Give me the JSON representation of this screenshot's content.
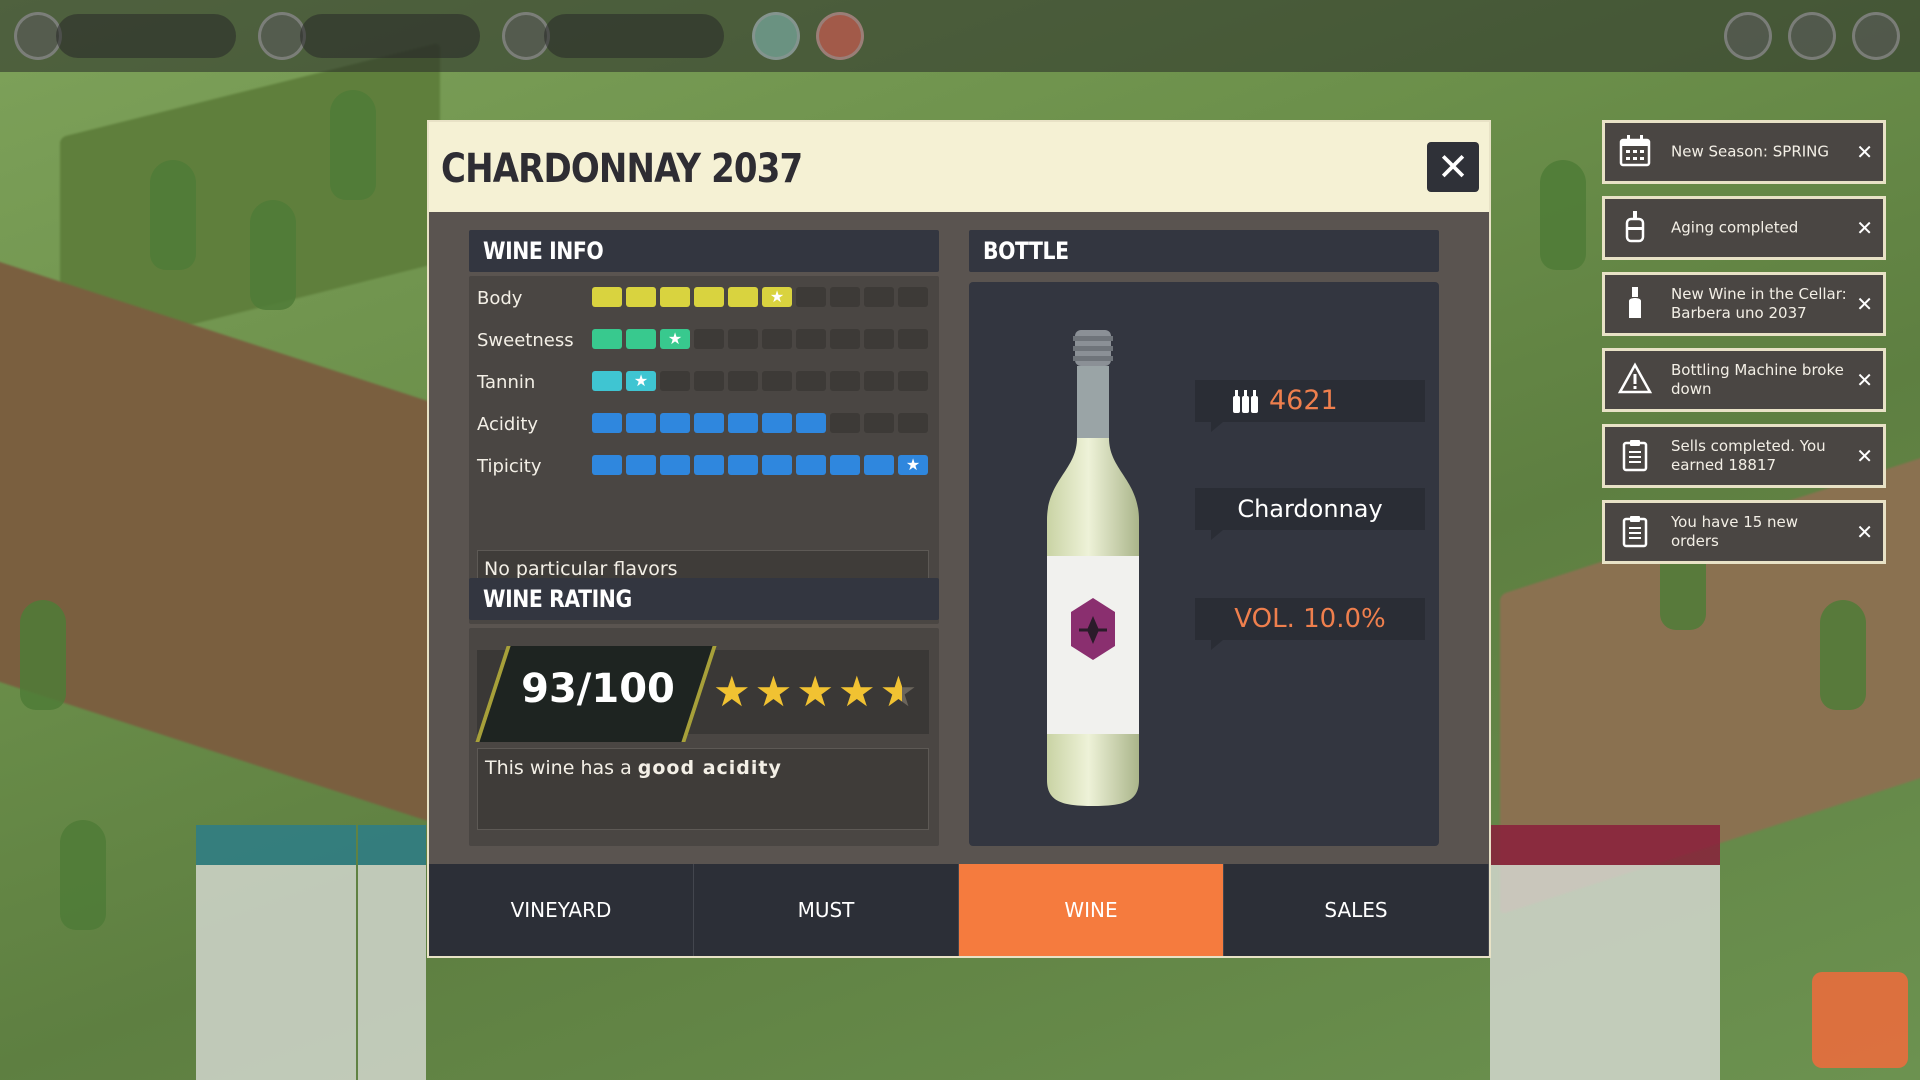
{
  "modal": {
    "title": "CHARDONNAY 2037",
    "close_label": "✕"
  },
  "wine_info": {
    "header": "WINE INFO",
    "attributes": [
      {
        "label": "Body",
        "filled": 6,
        "total": 10,
        "color": "#d9d33f",
        "star_at": 6
      },
      {
        "label": "Sweetness",
        "filled": 3,
        "total": 10,
        "color": "#38c98e",
        "star_at": 3
      },
      {
        "label": "Tannin",
        "filled": 2,
        "total": 10,
        "color": "#3fc5d2",
        "star_at": 2
      },
      {
        "label": "Acidity",
        "filled": 7,
        "total": 10,
        "color": "#2f87de",
        "star_at": 0
      },
      {
        "label": "Tipicity",
        "filled": 10,
        "total": 10,
        "color": "#2f87de",
        "star_at": 10
      }
    ],
    "flavors": "No particular flavors"
  },
  "wine_rating": {
    "header": "WINE RATING",
    "score": "93/100",
    "stars": 4.6,
    "description_prefix": "This wine has a ",
    "description_bold": "good acidity"
  },
  "bottle": {
    "header": "BOTTLE",
    "quantity": "4621",
    "variety": "Chardonnay",
    "volume": "VOL. 10.0%"
  },
  "tabs": [
    {
      "label": "VINEYARD",
      "active": false
    },
    {
      "label": "MUST",
      "active": false
    },
    {
      "label": "WINE",
      "active": true
    },
    {
      "label": "SALES",
      "active": false
    }
  ],
  "notifications": [
    {
      "icon": "calendar-icon",
      "text": "New Season: SPRING"
    },
    {
      "icon": "barrel-tap-icon",
      "text": "Aging completed"
    },
    {
      "icon": "wine-bottle-icon",
      "text": "New Wine in the Cellar: Barbera uno 2037"
    },
    {
      "icon": "warning-icon",
      "text": "Bottling Machine broke down"
    },
    {
      "icon": "clipboard-icon",
      "text": "Sells completed. You earned 18817"
    },
    {
      "icon": "clipboard-icon",
      "text": "You have 15 new orders"
    }
  ],
  "colors": {
    "accent_orange": "#f57b3e",
    "header_cream": "#f5f1d4",
    "panel_dark": "#333640"
  }
}
